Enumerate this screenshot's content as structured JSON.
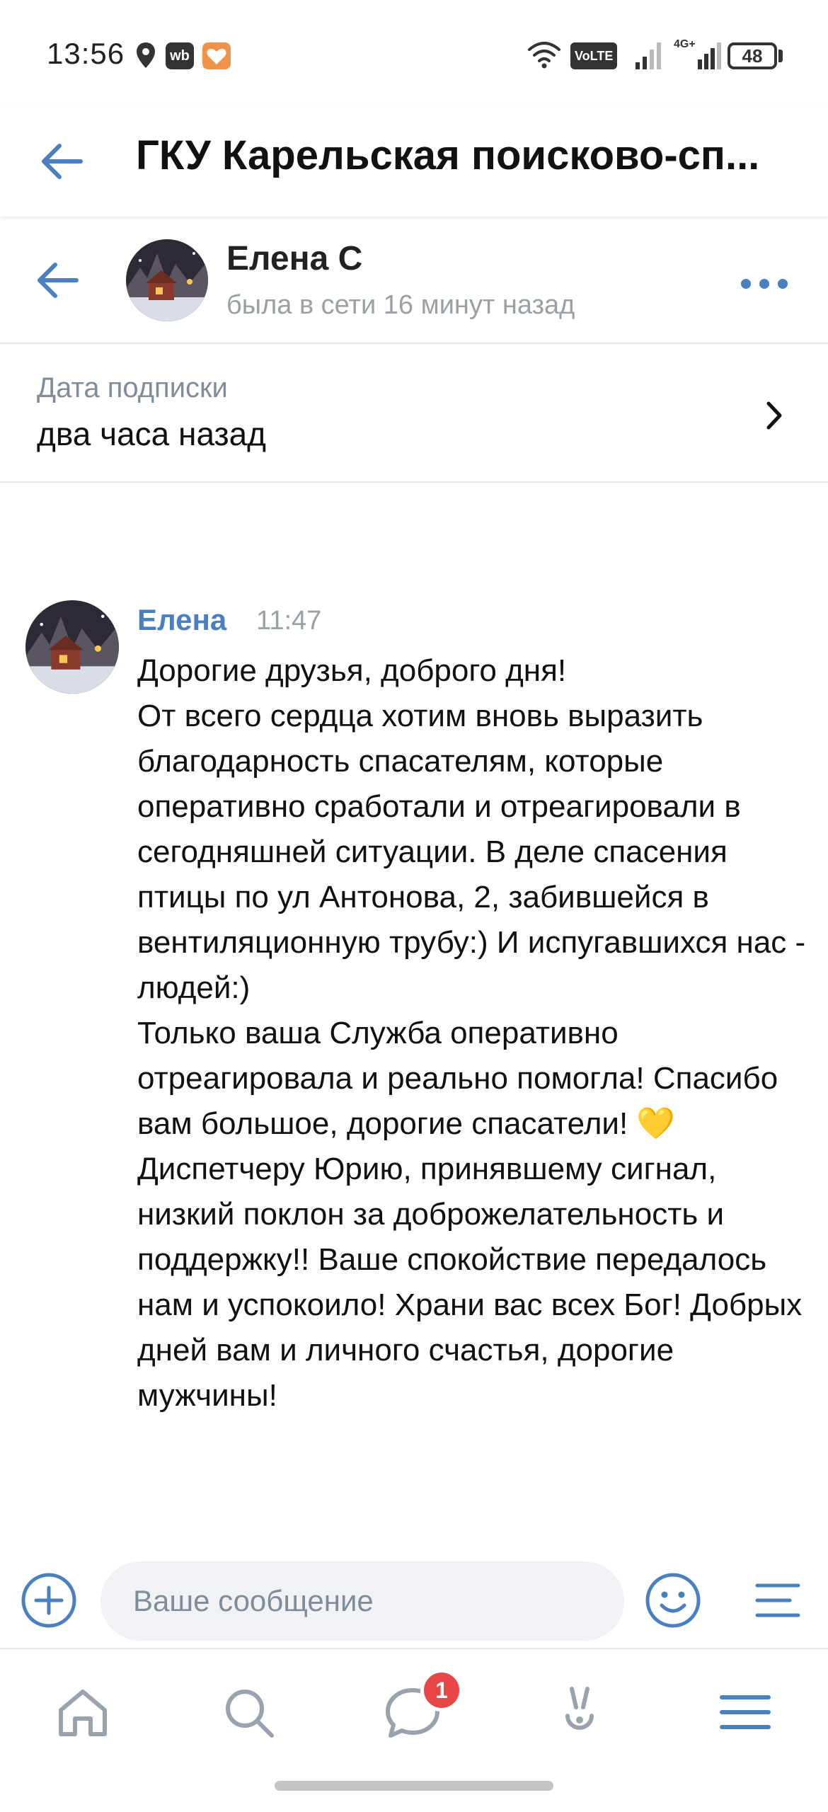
{
  "status_bar": {
    "time": "13:56",
    "wb_label": "wb",
    "volte_label": "VoLTE",
    "network_label": "4G+",
    "battery": "48",
    "icons": [
      "location-icon",
      "wb-app-icon",
      "heart-app-icon",
      "wifi-icon",
      "volte-icon",
      "signal-icon",
      "signal-4g-icon",
      "battery-icon"
    ]
  },
  "header": {
    "title": "ГКУ Карельская поисково-сп..."
  },
  "contact": {
    "name": "Елена С",
    "status": "была в сети 16 минут назад"
  },
  "subscription": {
    "label": "Дата подписки",
    "value": "два часа назад"
  },
  "message": {
    "author": "Елена",
    "time": "11:47",
    "paragraphs": [
      "Дорогие друзья, доброго дня!",
      "От всего сердца хотим вновь выразить благодарность спасателям, которые оперативно сработали и отреагировали в сегодняшней ситуации. В деле спасения птицы по ул Антонова, 2, забившейся в вентиляционную трубу:) И испугавшихся нас - людей:)",
      "Только ваша Служба оперативно отреагировала и реально помогла! Спасибо вам большое, дорогие спасатели! 💛",
      "Диспетчеру Юрию, принявшему сигнал, низкий поклон за доброжелательность и поддержку!! Ваше спокойствие передалось нам и успокоило! Храни вас всех Бог! Добрых дней вам и личного счастья, дорогие мужчины!"
    ]
  },
  "composer": {
    "placeholder": "Ваше сообщение"
  },
  "tab_bar": {
    "messages_badge": "1"
  },
  "colors": {
    "accent": "#4a7fc0",
    "badge": "#e64646",
    "secondary_text": "#818c99"
  }
}
